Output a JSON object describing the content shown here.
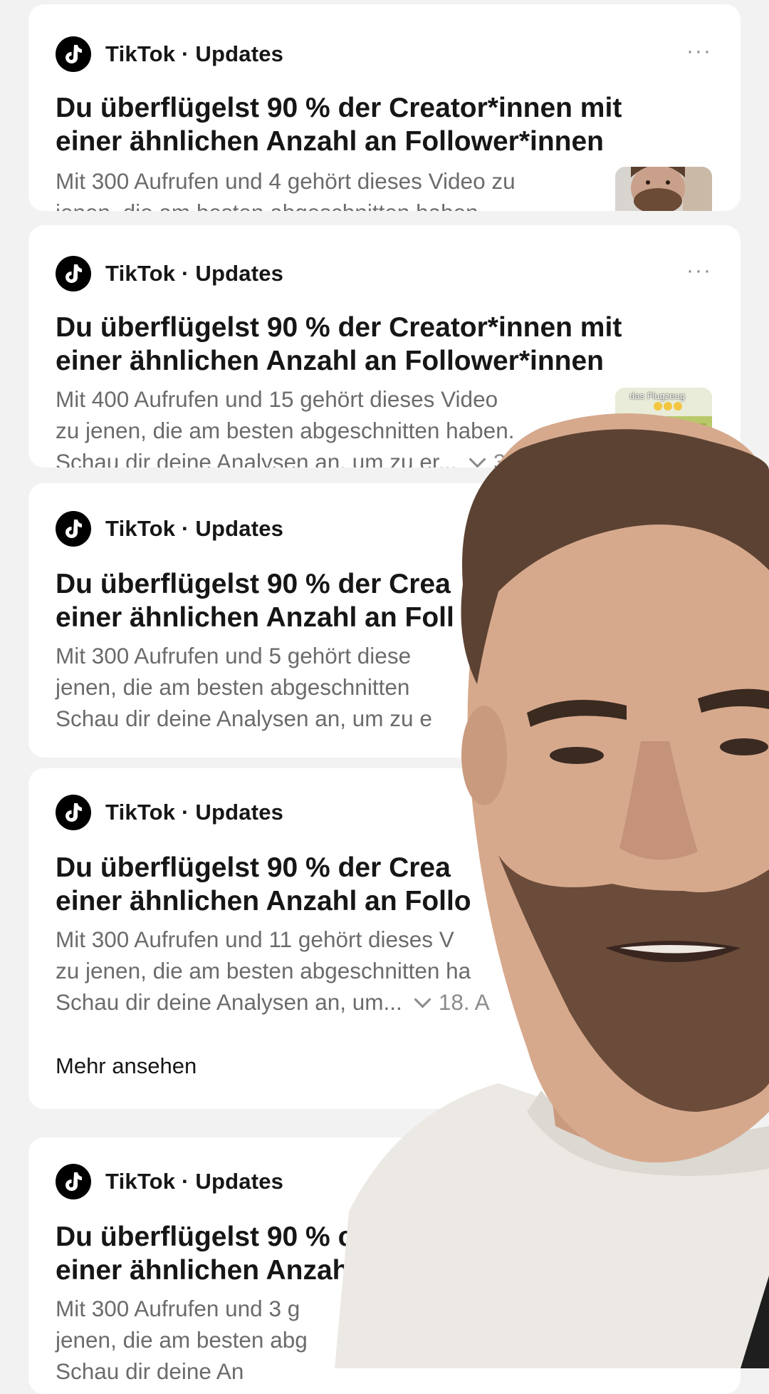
{
  "sender": "TikTok · Updates",
  "more_menu": "···",
  "cards": [
    {
      "title_l1": "Du überflügelst 90 % der Creator*innen mit",
      "title_l2": "einer ähnlichen Anzahl an Follower*innen",
      "body_l1": "Mit 300 Aufrufen und 4 gehört dieses Video zu",
      "body_l2": "jenen, die am besten abgeschnitten haben."
    },
    {
      "title_l1": "Du überflügelst 90 % der Creator*innen mit",
      "title_l2": "einer ähnlichen Anzahl an Follower*innen",
      "body_l1": "Mit 400 Aufrufen und 15 gehört dieses Video",
      "body_l2": "zu jenen, die am besten abgeschnitten haben.",
      "body_l3": "Schau dir deine Analysen an, um zu er...",
      "time": "3 T",
      "thumb_caption": "das Flugzeug"
    },
    {
      "title_l1": "Du überflügelst 90 % der Crea",
      "title_l2": "einer ähnlichen Anzahl an Foll",
      "body_l1": "Mit 300 Aufrufen und 5 gehört diese",
      "body_l2": "jenen, die am besten abgeschnitten",
      "body_l3": "Schau dir deine Analysen an, um zu e"
    },
    {
      "title_l1": "Du überflügelst 90 % der Crea",
      "title_l2": "einer ähnlichen Anzahl an Follo",
      "body_l1": "Mit 300 Aufrufen und 11 gehört dieses V",
      "body_l2": "zu jenen, die am besten abgeschnitten ha",
      "body_l3": "Schau dir deine Analysen an, um...",
      "time": "18. A",
      "more_link": "Mehr ansehen"
    },
    {
      "title_l1": "Du überflügelst 90 % c",
      "title_l2": "einer ähnlichen Anzah",
      "body_l1": "Mit 300 Aufrufen und 3 g",
      "body_l2": "jenen, die am besten abg",
      "body_l3": "Schau dir deine An"
    }
  ],
  "colors": {
    "background": "#f2f2f2",
    "card": "#ffffff",
    "title": "#161616",
    "body": "#6b6b6b",
    "logo": "#000000"
  },
  "icons": {
    "logo": "tiktok-logo-icon",
    "menu": "more-horizontal-icon",
    "expand": "chevron-down-icon"
  }
}
